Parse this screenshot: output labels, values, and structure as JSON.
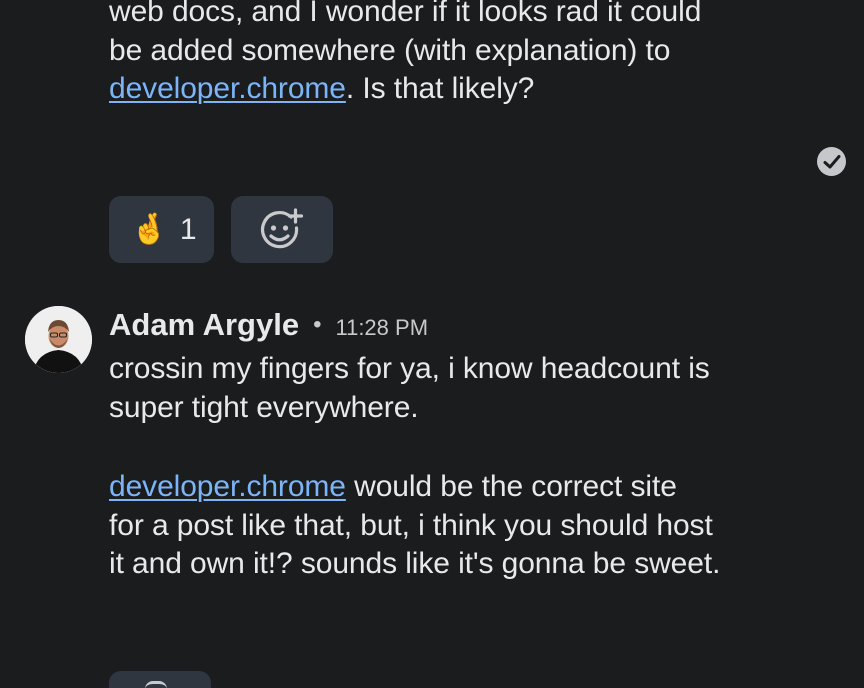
{
  "previous_message": {
    "line1": "web docs, and I wonder if it looks rad it could",
    "line2": "be added somewhere (with explanation) to",
    "link": "developer.chrome",
    "line3_rest": ". Is that likely?"
  },
  "seen_icon": "check-circle-icon",
  "reactions": [
    {
      "emoji": "🤞",
      "icon": "crossed-fingers-icon",
      "count": "1"
    }
  ],
  "add_reaction_icon": "add-reaction-icon",
  "message": {
    "author": "Adam Argyle",
    "separator": "•",
    "time": "11:28 PM",
    "paragraph1_line1": "crossin my fingers for ya, i know headcount is",
    "paragraph1_line2": "super tight everywhere.",
    "paragraph2_link": "developer.chrome",
    "paragraph2_line1_rest": " would be the correct site",
    "paragraph2_line2": "for a post like that, but, i think you should host",
    "paragraph2_line3": "it and own it!? sounds like it's gonna be sweet."
  },
  "colors": {
    "background": "#1b1c1e",
    "text": "#e8e9eb",
    "link": "#7cb4f7",
    "chip": "#30363f"
  }
}
